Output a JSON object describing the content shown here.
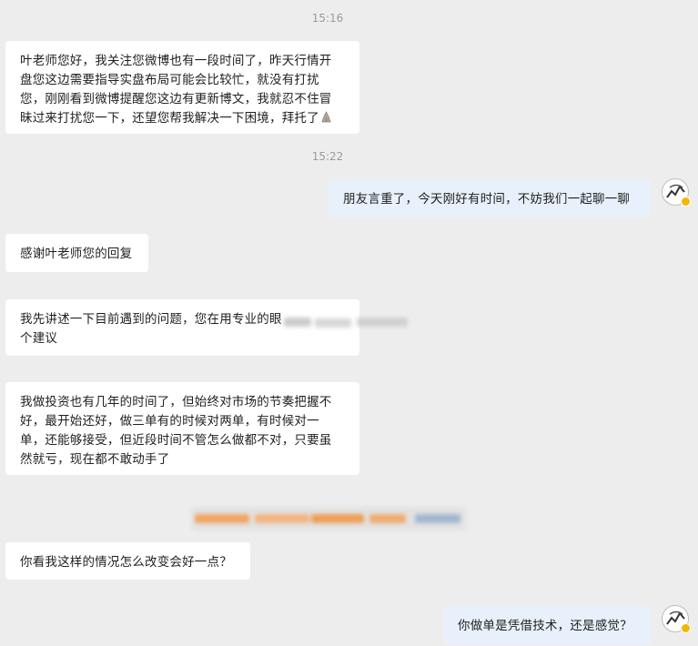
{
  "timestamps": [
    "15:16",
    "15:22"
  ],
  "messages": [
    {
      "side": "left",
      "lines": [
        "叶老师您好，我关注您微博也有一段时间了，昨天行情开",
        "盘您这边需要指导实盘布局可能会比较忙，就没有打扰",
        "您，刚刚看到微博提醒您这边有更新博文，我就忍不住冒",
        "昧过来打扰您一下，还望您帮我解决一下困境，拜托了"
      ],
      "trailing_icon": "praying-hands-icon"
    },
    {
      "side": "right",
      "lines": [
        "朋友言重了，今天刚好有时间，不妨我们一起聊一聊"
      ]
    },
    {
      "side": "left",
      "lines": [
        "感谢叶老师您的回复"
      ]
    },
    {
      "side": "left",
      "lines": [
        "我先讲述一下目前遇到的问题，您在用专业的眼",
        "个建议"
      ]
    },
    {
      "side": "left",
      "lines": [
        "我做投资也有几年的时间了，但始终对市场的节奏把握不",
        "好，最开始还好，做三单有的时候对两单，有时候对一",
        "单，还能够接受，但近段时间不管怎么做都不对，只要虽",
        "然就亏，现在都不敢动手了"
      ]
    },
    {
      "side": "left",
      "lines": [
        "你看我这样的情况怎么改变会好一点？"
      ]
    },
    {
      "side": "right",
      "lines": [
        "你做单是凭借技术，还是感觉？"
      ]
    }
  ],
  "colors": {
    "background": "#ededed",
    "left_bubble": "#ffffff",
    "right_bubble": "#e8f1fb",
    "timestamp": "#9b9b9b",
    "verified_badge": "#f2b705"
  }
}
